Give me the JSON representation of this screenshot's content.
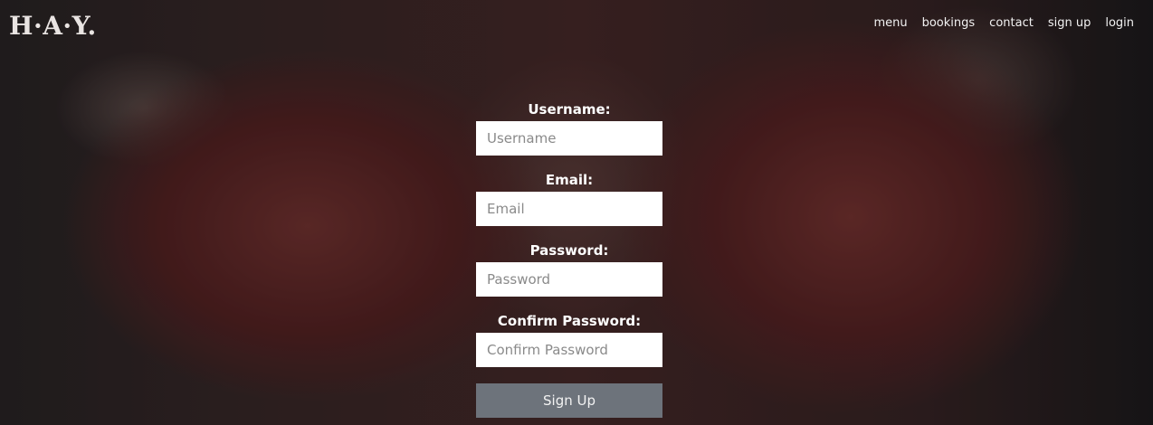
{
  "brand": {
    "logo_text": "H·A·Y."
  },
  "nav": {
    "items": [
      {
        "label": "menu"
      },
      {
        "label": "bookings"
      },
      {
        "label": "contact"
      },
      {
        "label": "sign up"
      },
      {
        "label": "login"
      }
    ]
  },
  "form": {
    "fields": [
      {
        "label": "Username:",
        "placeholder": "Username",
        "value": ""
      },
      {
        "label": "Email:",
        "placeholder": "Email",
        "value": ""
      },
      {
        "label": "Password:",
        "placeholder": "Password",
        "value": ""
      },
      {
        "label": "Confirm Password:",
        "placeholder": "Confirm Password",
        "value": ""
      }
    ],
    "submit_label": "Sign Up"
  },
  "colors": {
    "button_bg": "#6d737b",
    "input_bg": "#ffffff",
    "text": "#ffffff"
  }
}
